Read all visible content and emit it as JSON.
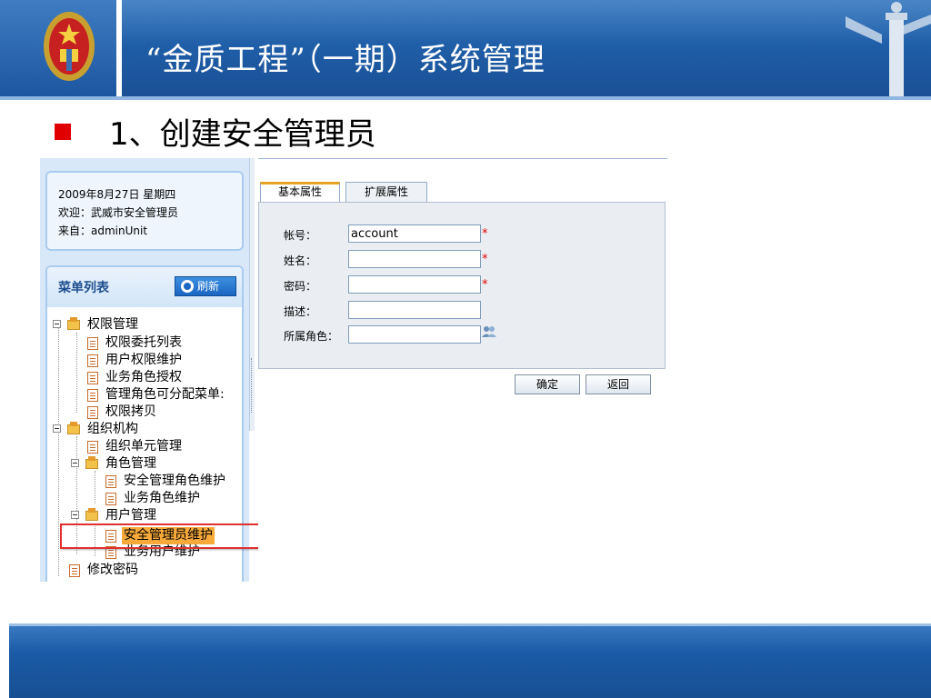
{
  "slide": {
    "title": "“金质工程”（一期）系统管理",
    "bullet": "1、创建安全管理员"
  },
  "info": {
    "date_line": "2009年8月27日 星期四",
    "welcome_line": "欢迎：武威市安全管理员",
    "from_line": "来自：adminUnit"
  },
  "menu": {
    "title": "菜单列表",
    "refresh_label": "刷新",
    "tree": [
      {
        "label": "权限管理",
        "type": "folder"
      },
      {
        "label": "权限委托列表",
        "type": "doc"
      },
      {
        "label": "用户权限维护",
        "type": "doc"
      },
      {
        "label": "业务角色授权",
        "type": "doc"
      },
      {
        "label": "管理角色可分配菜单:",
        "type": "doc"
      },
      {
        "label": "权限拷贝",
        "type": "doc"
      },
      {
        "label": "组织机构",
        "type": "folder"
      },
      {
        "label": "组织单元管理",
        "type": "doc"
      },
      {
        "label": "角色管理",
        "type": "folder"
      },
      {
        "label": "安全管理角色维护",
        "type": "doc"
      },
      {
        "label": "业务角色维护",
        "type": "doc"
      },
      {
        "label": "用户管理",
        "type": "folder"
      },
      {
        "label": "安全管理员维护",
        "type": "doc",
        "highlighted": true
      },
      {
        "label": "业务用户维护",
        "type": "doc"
      },
      {
        "label": "修改密码",
        "type": "doc"
      }
    ]
  },
  "tabs": {
    "basic": "基本属性",
    "extended": "扩展属性"
  },
  "form": {
    "account_label": "帐号：",
    "account_value": "account",
    "name_label": "姓名：",
    "password_label": "密码：",
    "desc_label": "描述：",
    "role_label": "所属角色：",
    "required_mark": "*"
  },
  "buttons": {
    "ok": "确定",
    "back": "返回"
  },
  "colors": {
    "header_blue": "#1f5ea8",
    "bullet_red": "#e00000",
    "highlight_orange": "#f7a93a",
    "annotation_red": "#e03030"
  }
}
